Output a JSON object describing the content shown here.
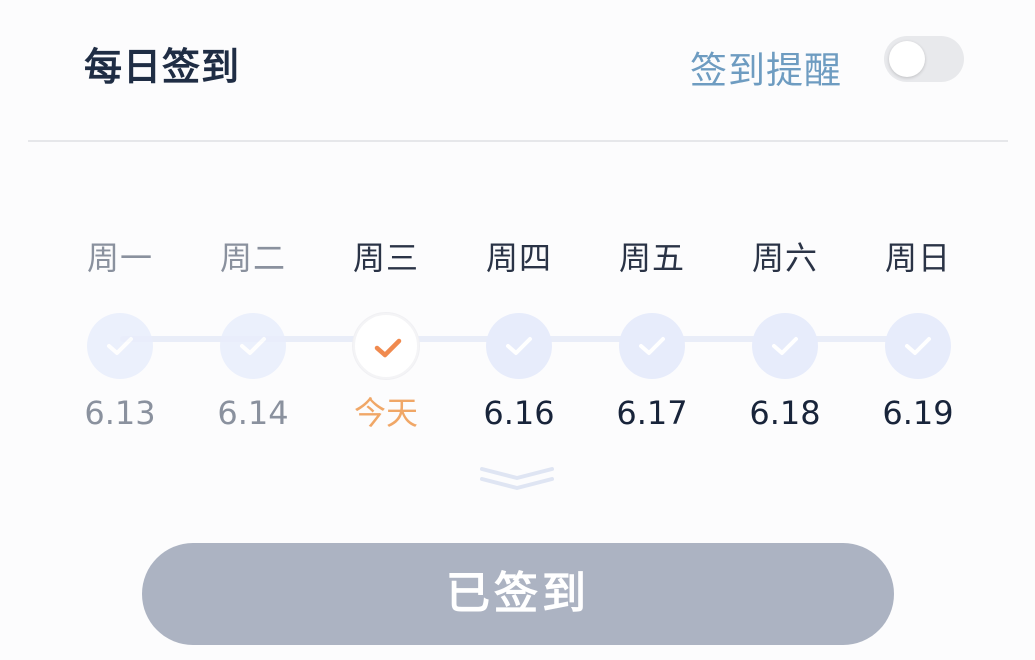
{
  "header": {
    "title": "每日签到",
    "reminder_label": "签到提醒",
    "reminder_enabled": false
  },
  "week": {
    "days": [
      {
        "weekday": "周一",
        "date": "6.13",
        "state": "past"
      },
      {
        "weekday": "周二",
        "date": "6.14",
        "state": "past"
      },
      {
        "weekday": "周三",
        "date": "今天",
        "state": "today"
      },
      {
        "weekday": "周四",
        "date": "6.16",
        "state": "future"
      },
      {
        "weekday": "周五",
        "date": "6.17",
        "state": "future"
      },
      {
        "weekday": "周六",
        "date": "6.18",
        "state": "future"
      },
      {
        "weekday": "周日",
        "date": "6.19",
        "state": "future"
      }
    ]
  },
  "expand_icon": "double-chevron-down-icon",
  "action": {
    "button_label": "已签到"
  },
  "colors": {
    "title": "#1f2d44",
    "reminder": "#6e9cc1",
    "today_check": "#f08a4f",
    "today_text": "#f0a767",
    "check_circle": "#e7ecfb",
    "button_bg": "#acb3c2"
  }
}
